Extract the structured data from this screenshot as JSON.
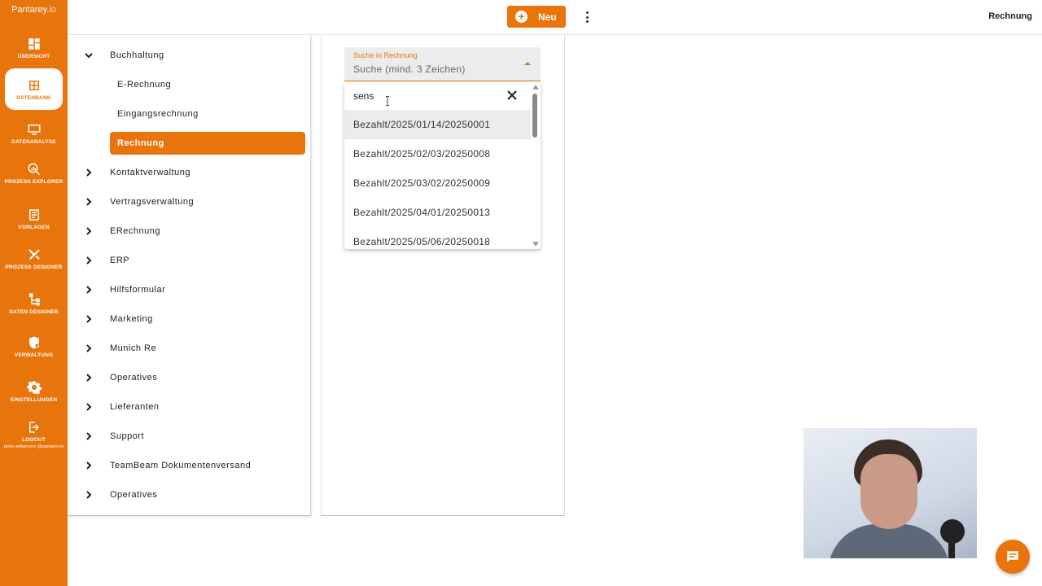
{
  "brand": {
    "name": "Pantarey",
    "suffix": ".io"
  },
  "sidebar": {
    "items": [
      {
        "label": "ÜBERSICHT",
        "icon": "dashboard-icon"
      },
      {
        "label": "DATENBANK",
        "icon": "grid-icon",
        "active": true
      },
      {
        "label": "DATENANALYSE",
        "icon": "monitor-icon"
      },
      {
        "label": "PROZESS EXPLORER",
        "icon": "search-chart-icon"
      },
      {
        "label": "VORLAGEN",
        "icon": "template-icon"
      },
      {
        "label": "PROZESS DESIGNER",
        "icon": "tools-icon"
      },
      {
        "label": "DATEN DESIGNER",
        "icon": "schema-icon"
      },
      {
        "label": "VERWALTUNG",
        "icon": "admin-shield-icon"
      },
      {
        "label": "EINSTELLUNGEN",
        "icon": "gear-icon"
      },
      {
        "label": "LOGOUT",
        "icon": "logout-icon",
        "user": "peter.veltan+pro @pantarey.io"
      }
    ]
  },
  "topbar": {
    "new_label": "Neu",
    "page_title": "Rechnung"
  },
  "tree": {
    "items": [
      {
        "label": "Buchhaltung",
        "expanded": true
      },
      {
        "label": "E-Rechnung",
        "child": true
      },
      {
        "label": "Eingangsrechnung",
        "child": true
      },
      {
        "label": "Rechnung",
        "child": true,
        "selected": true
      },
      {
        "label": "Kontaktverwaltung"
      },
      {
        "label": "Vertragsverwaltung"
      },
      {
        "label": "ERechnung"
      },
      {
        "label": "ERP"
      },
      {
        "label": "Hilfsformular"
      },
      {
        "label": "Marketing"
      },
      {
        "label": "Munich Re"
      },
      {
        "label": "Operatives"
      },
      {
        "label": "Lieferanten"
      },
      {
        "label": "Support"
      },
      {
        "label": "TeamBeam Dokumentenversand"
      },
      {
        "label": "Operatives"
      }
    ]
  },
  "search": {
    "label": "Suche in Rechnung",
    "placeholder": "Suche (mind. 3 Zeichen)",
    "query": "sens",
    "options": [
      "Bezahlt/2025/01/14/20250001",
      "Bezahlt/2025/02/03/20250008",
      "Bezahlt/2025/03/02/20250009",
      "Bezahlt/2025/04/01/20250013",
      "Bezahlt/2025/05/06/20250018"
    ]
  },
  "colors": {
    "accent": "#e8740c",
    "field_bg": "#ececec"
  }
}
